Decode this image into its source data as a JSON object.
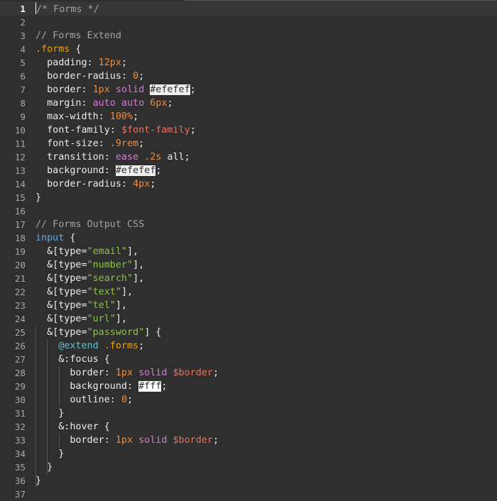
{
  "editor": {
    "current_line": 1,
    "lines": [
      {
        "n": "1",
        "tokens": [
          {
            "t": "/* Forms */",
            "k": "comment"
          }
        ]
      },
      {
        "n": "2",
        "tokens": []
      },
      {
        "n": "3",
        "tokens": [
          {
            "t": "// Forms Extend",
            "k": "comment"
          }
        ]
      },
      {
        "n": "4",
        "tokens": [
          {
            "t": ".forms",
            "k": "sel"
          },
          {
            "t": " {",
            "k": "punc"
          }
        ]
      },
      {
        "n": "5",
        "tokens": [
          {
            "t": "  padding: ",
            "k": "prop"
          },
          {
            "t": "12px",
            "k": "num"
          },
          {
            "t": ";",
            "k": "punc"
          }
        ]
      },
      {
        "n": "6",
        "tokens": [
          {
            "t": "  border-radius: ",
            "k": "prop"
          },
          {
            "t": "0",
            "k": "num"
          },
          {
            "t": ";",
            "k": "punc"
          }
        ]
      },
      {
        "n": "7",
        "tokens": [
          {
            "t": "  border: ",
            "k": "prop"
          },
          {
            "t": "1px",
            "k": "num"
          },
          {
            "t": " ",
            "k": "punc"
          },
          {
            "t": "solid",
            "k": "kw"
          },
          {
            "t": " ",
            "k": "punc"
          },
          {
            "t": "#efefef",
            "k": "swatch"
          },
          {
            "t": ";",
            "k": "punc"
          }
        ]
      },
      {
        "n": "8",
        "tokens": [
          {
            "t": "  margin: ",
            "k": "prop"
          },
          {
            "t": "auto auto",
            "k": "kw"
          },
          {
            "t": " ",
            "k": "punc"
          },
          {
            "t": "6px",
            "k": "num"
          },
          {
            "t": ";",
            "k": "punc"
          }
        ]
      },
      {
        "n": "9",
        "tokens": [
          {
            "t": "  max-width: ",
            "k": "prop"
          },
          {
            "t": "100%",
            "k": "num"
          },
          {
            "t": ";",
            "k": "punc"
          }
        ]
      },
      {
        "n": "10",
        "tokens": [
          {
            "t": "  font-family: ",
            "k": "prop"
          },
          {
            "t": "$font-family",
            "k": "var"
          },
          {
            "t": ";",
            "k": "punc"
          }
        ]
      },
      {
        "n": "11",
        "tokens": [
          {
            "t": "  font-size: ",
            "k": "prop"
          },
          {
            "t": ".9rem",
            "k": "num"
          },
          {
            "t": ";",
            "k": "punc"
          }
        ]
      },
      {
        "n": "12",
        "tokens": [
          {
            "t": "  transition: ",
            "k": "prop"
          },
          {
            "t": "ease",
            "k": "kw"
          },
          {
            "t": " ",
            "k": "punc"
          },
          {
            "t": ".2s",
            "k": "num"
          },
          {
            "t": " all;",
            "k": "punc"
          }
        ]
      },
      {
        "n": "13",
        "tokens": [
          {
            "t": "  background: ",
            "k": "prop"
          },
          {
            "t": "#efefef",
            "k": "swatch"
          },
          {
            "t": ";",
            "k": "punc"
          }
        ]
      },
      {
        "n": "14",
        "tokens": [
          {
            "t": "  border-radius: ",
            "k": "prop"
          },
          {
            "t": "4px",
            "k": "num"
          },
          {
            "t": ";",
            "k": "punc"
          }
        ]
      },
      {
        "n": "15",
        "tokens": [
          {
            "t": "}",
            "k": "punc"
          }
        ]
      },
      {
        "n": "16",
        "tokens": []
      },
      {
        "n": "17",
        "tokens": [
          {
            "t": "// Forms Output CSS",
            "k": "comment"
          }
        ]
      },
      {
        "n": "18",
        "tokens": [
          {
            "t": "input",
            "k": "tag"
          },
          {
            "t": " {",
            "k": "punc"
          }
        ]
      },
      {
        "n": "19",
        "tokens": [
          {
            "t": "  &[type=",
            "k": "punc"
          },
          {
            "t": "\"email\"",
            "k": "str"
          },
          {
            "t": "],",
            "k": "punc"
          }
        ]
      },
      {
        "n": "20",
        "tokens": [
          {
            "t": "  &[type=",
            "k": "punc"
          },
          {
            "t": "\"number\"",
            "k": "str"
          },
          {
            "t": "],",
            "k": "punc"
          }
        ]
      },
      {
        "n": "21",
        "tokens": [
          {
            "t": "  &[type=",
            "k": "punc"
          },
          {
            "t": "\"search\"",
            "k": "str"
          },
          {
            "t": "],",
            "k": "punc"
          }
        ]
      },
      {
        "n": "22",
        "tokens": [
          {
            "t": "  &[type=",
            "k": "punc"
          },
          {
            "t": "\"text\"",
            "k": "str"
          },
          {
            "t": "],",
            "k": "punc"
          }
        ]
      },
      {
        "n": "23",
        "tokens": [
          {
            "t": "  &[type=",
            "k": "punc"
          },
          {
            "t": "\"tel\"",
            "k": "str"
          },
          {
            "t": "],",
            "k": "punc"
          }
        ]
      },
      {
        "n": "24",
        "tokens": [
          {
            "t": "  &[type=",
            "k": "punc"
          },
          {
            "t": "\"url\"",
            "k": "str"
          },
          {
            "t": "],",
            "k": "punc"
          }
        ]
      },
      {
        "n": "25",
        "tokens": [
          {
            "t": "  &[type=",
            "k": "punc"
          },
          {
            "t": "\"password\"",
            "k": "str"
          },
          {
            "t": "] {",
            "k": "punc"
          }
        ]
      },
      {
        "n": "26",
        "tokens": [
          {
            "t": "    ",
            "k": "punc"
          },
          {
            "t": "@extend",
            "k": "at"
          },
          {
            "t": " ",
            "k": "punc"
          },
          {
            "t": ".forms",
            "k": "sel"
          },
          {
            "t": ";",
            "k": "punc"
          }
        ]
      },
      {
        "n": "27",
        "tokens": [
          {
            "t": "    &:focus {",
            "k": "punc"
          }
        ]
      },
      {
        "n": "28",
        "tokens": [
          {
            "t": "      border: ",
            "k": "prop"
          },
          {
            "t": "1px",
            "k": "num"
          },
          {
            "t": " ",
            "k": "punc"
          },
          {
            "t": "solid",
            "k": "kw"
          },
          {
            "t": " ",
            "k": "punc"
          },
          {
            "t": "$border",
            "k": "var"
          },
          {
            "t": ";",
            "k": "punc"
          }
        ]
      },
      {
        "n": "29",
        "tokens": [
          {
            "t": "      background: ",
            "k": "prop"
          },
          {
            "t": "#fff",
            "k": "swatch-w"
          },
          {
            "t": ";",
            "k": "punc"
          }
        ]
      },
      {
        "n": "30",
        "tokens": [
          {
            "t": "      outline: ",
            "k": "prop"
          },
          {
            "t": "0",
            "k": "num"
          },
          {
            "t": ";",
            "k": "punc"
          }
        ]
      },
      {
        "n": "31",
        "tokens": [
          {
            "t": "    }",
            "k": "punc"
          }
        ]
      },
      {
        "n": "32",
        "tokens": [
          {
            "t": "    &:hover {",
            "k": "punc"
          }
        ]
      },
      {
        "n": "33",
        "tokens": [
          {
            "t": "      border: ",
            "k": "prop"
          },
          {
            "t": "1px",
            "k": "num"
          },
          {
            "t": " ",
            "k": "punc"
          },
          {
            "t": "solid",
            "k": "kw"
          },
          {
            "t": " ",
            "k": "punc"
          },
          {
            "t": "$border",
            "k": "var"
          },
          {
            "t": ";",
            "k": "punc"
          }
        ]
      },
      {
        "n": "34",
        "tokens": [
          {
            "t": "    }",
            "k": "punc"
          }
        ]
      },
      {
        "n": "35",
        "tokens": [
          {
            "t": "  }",
            "k": "punc"
          }
        ]
      },
      {
        "n": "36",
        "tokens": [
          {
            "t": "}",
            "k": "punc"
          }
        ]
      },
      {
        "n": "37",
        "tokens": []
      }
    ]
  }
}
